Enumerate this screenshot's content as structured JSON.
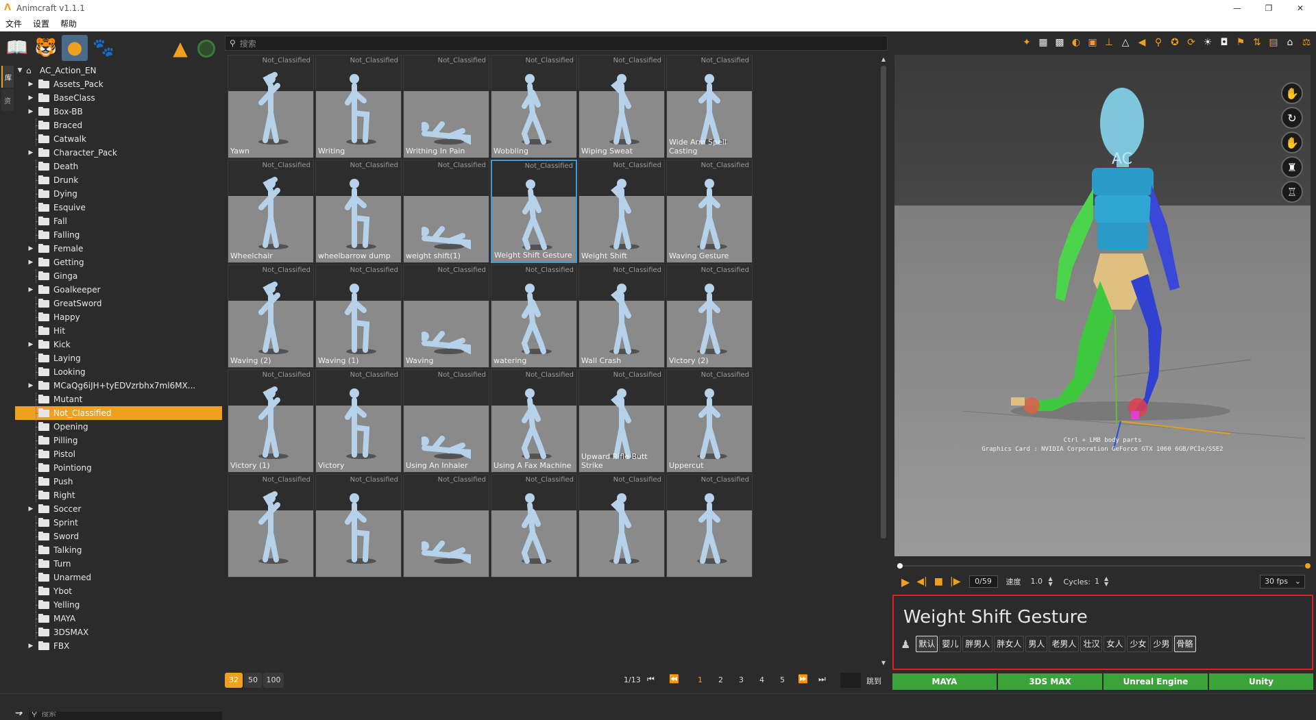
{
  "app": {
    "title": "Animcraft v1.1.1"
  },
  "window_buttons": {
    "minimize": "—",
    "maximize": "❐",
    "close": "✕"
  },
  "menu": [
    "文件",
    "设置",
    "帮助"
  ],
  "left_tabs": [
    "库",
    "资"
  ],
  "tree": {
    "root": "AC_Action_EN",
    "items": [
      {
        "label": "Assets_Pack",
        "expandable": true
      },
      {
        "label": "BaseClass",
        "expandable": true
      },
      {
        "label": "Box-BB",
        "expandable": true
      },
      {
        "label": "Braced",
        "expandable": false
      },
      {
        "label": "Catwalk",
        "expandable": false
      },
      {
        "label": "Character_Pack",
        "expandable": true
      },
      {
        "label": "Death",
        "expandable": false
      },
      {
        "label": "Drunk",
        "expandable": false
      },
      {
        "label": "Dying",
        "expandable": false
      },
      {
        "label": "Esquive",
        "expandable": false
      },
      {
        "label": "Fall",
        "expandable": false
      },
      {
        "label": "Falling",
        "expandable": false
      },
      {
        "label": "Female",
        "expandable": true
      },
      {
        "label": "Getting",
        "expandable": true
      },
      {
        "label": "Ginga",
        "expandable": false
      },
      {
        "label": "Goalkeeper",
        "expandable": true
      },
      {
        "label": "GreatSword",
        "expandable": false
      },
      {
        "label": "Happy",
        "expandable": false
      },
      {
        "label": "Hit",
        "expandable": false
      },
      {
        "label": "Kick",
        "expandable": true
      },
      {
        "label": "Laying",
        "expandable": false
      },
      {
        "label": "Looking",
        "expandable": false
      },
      {
        "label": "MCaQg6iJH+tyEDVzrbhx7ml6MX...",
        "expandable": true
      },
      {
        "label": "Mutant",
        "expandable": false
      },
      {
        "label": "Not_Classified",
        "expandable": false,
        "selected": true
      },
      {
        "label": "Opening",
        "expandable": false
      },
      {
        "label": "Pilling",
        "expandable": false
      },
      {
        "label": "Pistol",
        "expandable": false
      },
      {
        "label": "Pointiong",
        "expandable": false
      },
      {
        "label": "Push",
        "expandable": false
      },
      {
        "label": "Right",
        "expandable": false
      },
      {
        "label": "Soccer",
        "expandable": true
      },
      {
        "label": "Sprint",
        "expandable": false
      },
      {
        "label": "Sword",
        "expandable": false
      },
      {
        "label": "Talking",
        "expandable": false
      },
      {
        "label": "Turn",
        "expandable": false
      },
      {
        "label": "Unarmed",
        "expandable": false
      },
      {
        "label": "Ybot",
        "expandable": false
      },
      {
        "label": "Yelling",
        "expandable": false
      },
      {
        "label": "MAYA",
        "expandable": false
      },
      {
        "label": "3DSMAX",
        "expandable": false
      },
      {
        "label": "FBX",
        "expandable": true
      }
    ]
  },
  "tree_search": {
    "placeholder": "搜索"
  },
  "main_search": {
    "placeholder": "搜索"
  },
  "grid": {
    "class_label": "Not_Classified",
    "cards": [
      "Yawn",
      "Writing",
      "Writhing In Pain",
      "Wobbling",
      "Wiping Sweat",
      "Wide Arm Spell Casting",
      "Wheelchair",
      "wheelbarrow dump",
      "weight shift(1)",
      "Weight Shift Gesture",
      "Weight Shift",
      "Waving Gesture",
      "Waving (2)",
      "Waving (1)",
      "Waving",
      "watering",
      "Wall Crash",
      "Victory (2)",
      "Victory (1)",
      "Victory",
      "Using An Inhaler",
      "Using A Fax Machine",
      "Upward Rifle Butt Strike",
      "Uppercut",
      "",
      "",
      "",
      "",
      "",
      ""
    ],
    "selected_index": 9
  },
  "pager": {
    "sizes": [
      "32",
      "50",
      "100"
    ],
    "active_size": "32",
    "page_info": "1/13",
    "pages": [
      "1",
      "2",
      "3",
      "4",
      "5"
    ],
    "current_page": "1",
    "goto_label": "跳到"
  },
  "viewport": {
    "hint_line1": "Ctrl + LMB body parts",
    "hint_line2": "Graphics Card : NVIDIA Corporation GeForce GTX 1060 6GB/PCIe/SSE2",
    "chest_label": "AC"
  },
  "playback": {
    "frame": "0/59",
    "speed_label": "速度",
    "speed": "1.0",
    "cycles_label": "Cycles:",
    "cycles": "1",
    "fps": "30 fps"
  },
  "info": {
    "title": "Weight Shift Gesture",
    "tags": [
      "默认",
      "婴儿",
      "胖男人",
      "胖女人",
      "男人",
      "老男人",
      "壮汉",
      "女人",
      "少女",
      "少男",
      "骨骼"
    ],
    "active_tags": [
      0,
      10
    ]
  },
  "export": [
    "MAYA",
    "3DS MAX",
    "Unreal Engine",
    "Unity"
  ],
  "colors": {
    "accent": "#f0a020",
    "selection": "#3d9be0",
    "export_green": "#3aa33a",
    "highlight_red": "#e02020"
  }
}
